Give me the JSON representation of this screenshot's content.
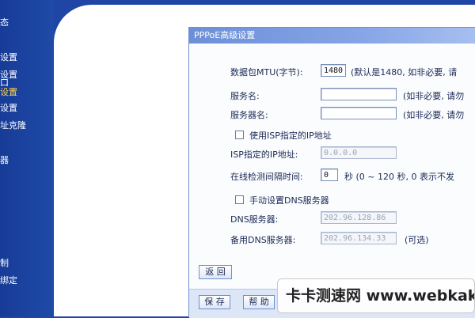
{
  "sidebar": {
    "items": [
      {
        "label": "态",
        "active": false
      },
      {
        "label": "设置",
        "active": false
      },
      {
        "label": "设置",
        "active": false
      },
      {
        "label": "口",
        "active": false
      },
      {
        "label": "设置",
        "active": true
      },
      {
        "label": "设置",
        "active": false
      },
      {
        "label": "址克隆",
        "active": false
      },
      {
        "label": "",
        "active": false
      },
      {
        "label": "器",
        "active": false
      },
      {
        "label": "",
        "active": false
      },
      {
        "label": "",
        "active": false
      },
      {
        "label": "",
        "active": false
      },
      {
        "label": "",
        "active": false
      },
      {
        "label": "",
        "active": false
      },
      {
        "label": "",
        "active": false
      },
      {
        "label": "制",
        "active": false
      },
      {
        "label": "绑定",
        "active": false
      }
    ]
  },
  "panel": {
    "title": "PPPoE高级设置",
    "mtu": {
      "label": "数据包MTU(字节):",
      "value": "1480",
      "hint": "(默认是1480, 如非必要, 请"
    },
    "service_name": {
      "label": "服务名:",
      "value": "",
      "hint": "(如非必要, 请勿"
    },
    "server_name": {
      "label": "服务器名:",
      "value": "",
      "hint": "(如非必要, 请勿"
    },
    "use_isp_ip": {
      "label": "使用ISP指定的IP地址",
      "checked": false
    },
    "isp_ip": {
      "label": "ISP指定的IP地址:",
      "value": "0.0.0.0"
    },
    "online_check": {
      "label": "在线检测间隔时间:",
      "value": "0",
      "hint": "秒 (0 ~ 120 秒, 0 表示不发"
    },
    "manual_dns": {
      "label": "手动设置DNS服务器",
      "checked": false
    },
    "dns": {
      "label": "DNS服务器:",
      "value": "202.96.128.86"
    },
    "backup_dns": {
      "label": "备用DNS服务器:",
      "value": "202.96.134.33",
      "hint": "(可选)"
    },
    "back_button": "返 回",
    "save_button": "保 存",
    "help_button": "帮 助"
  },
  "watermark": "卡卡测速网 www.webkaka"
}
